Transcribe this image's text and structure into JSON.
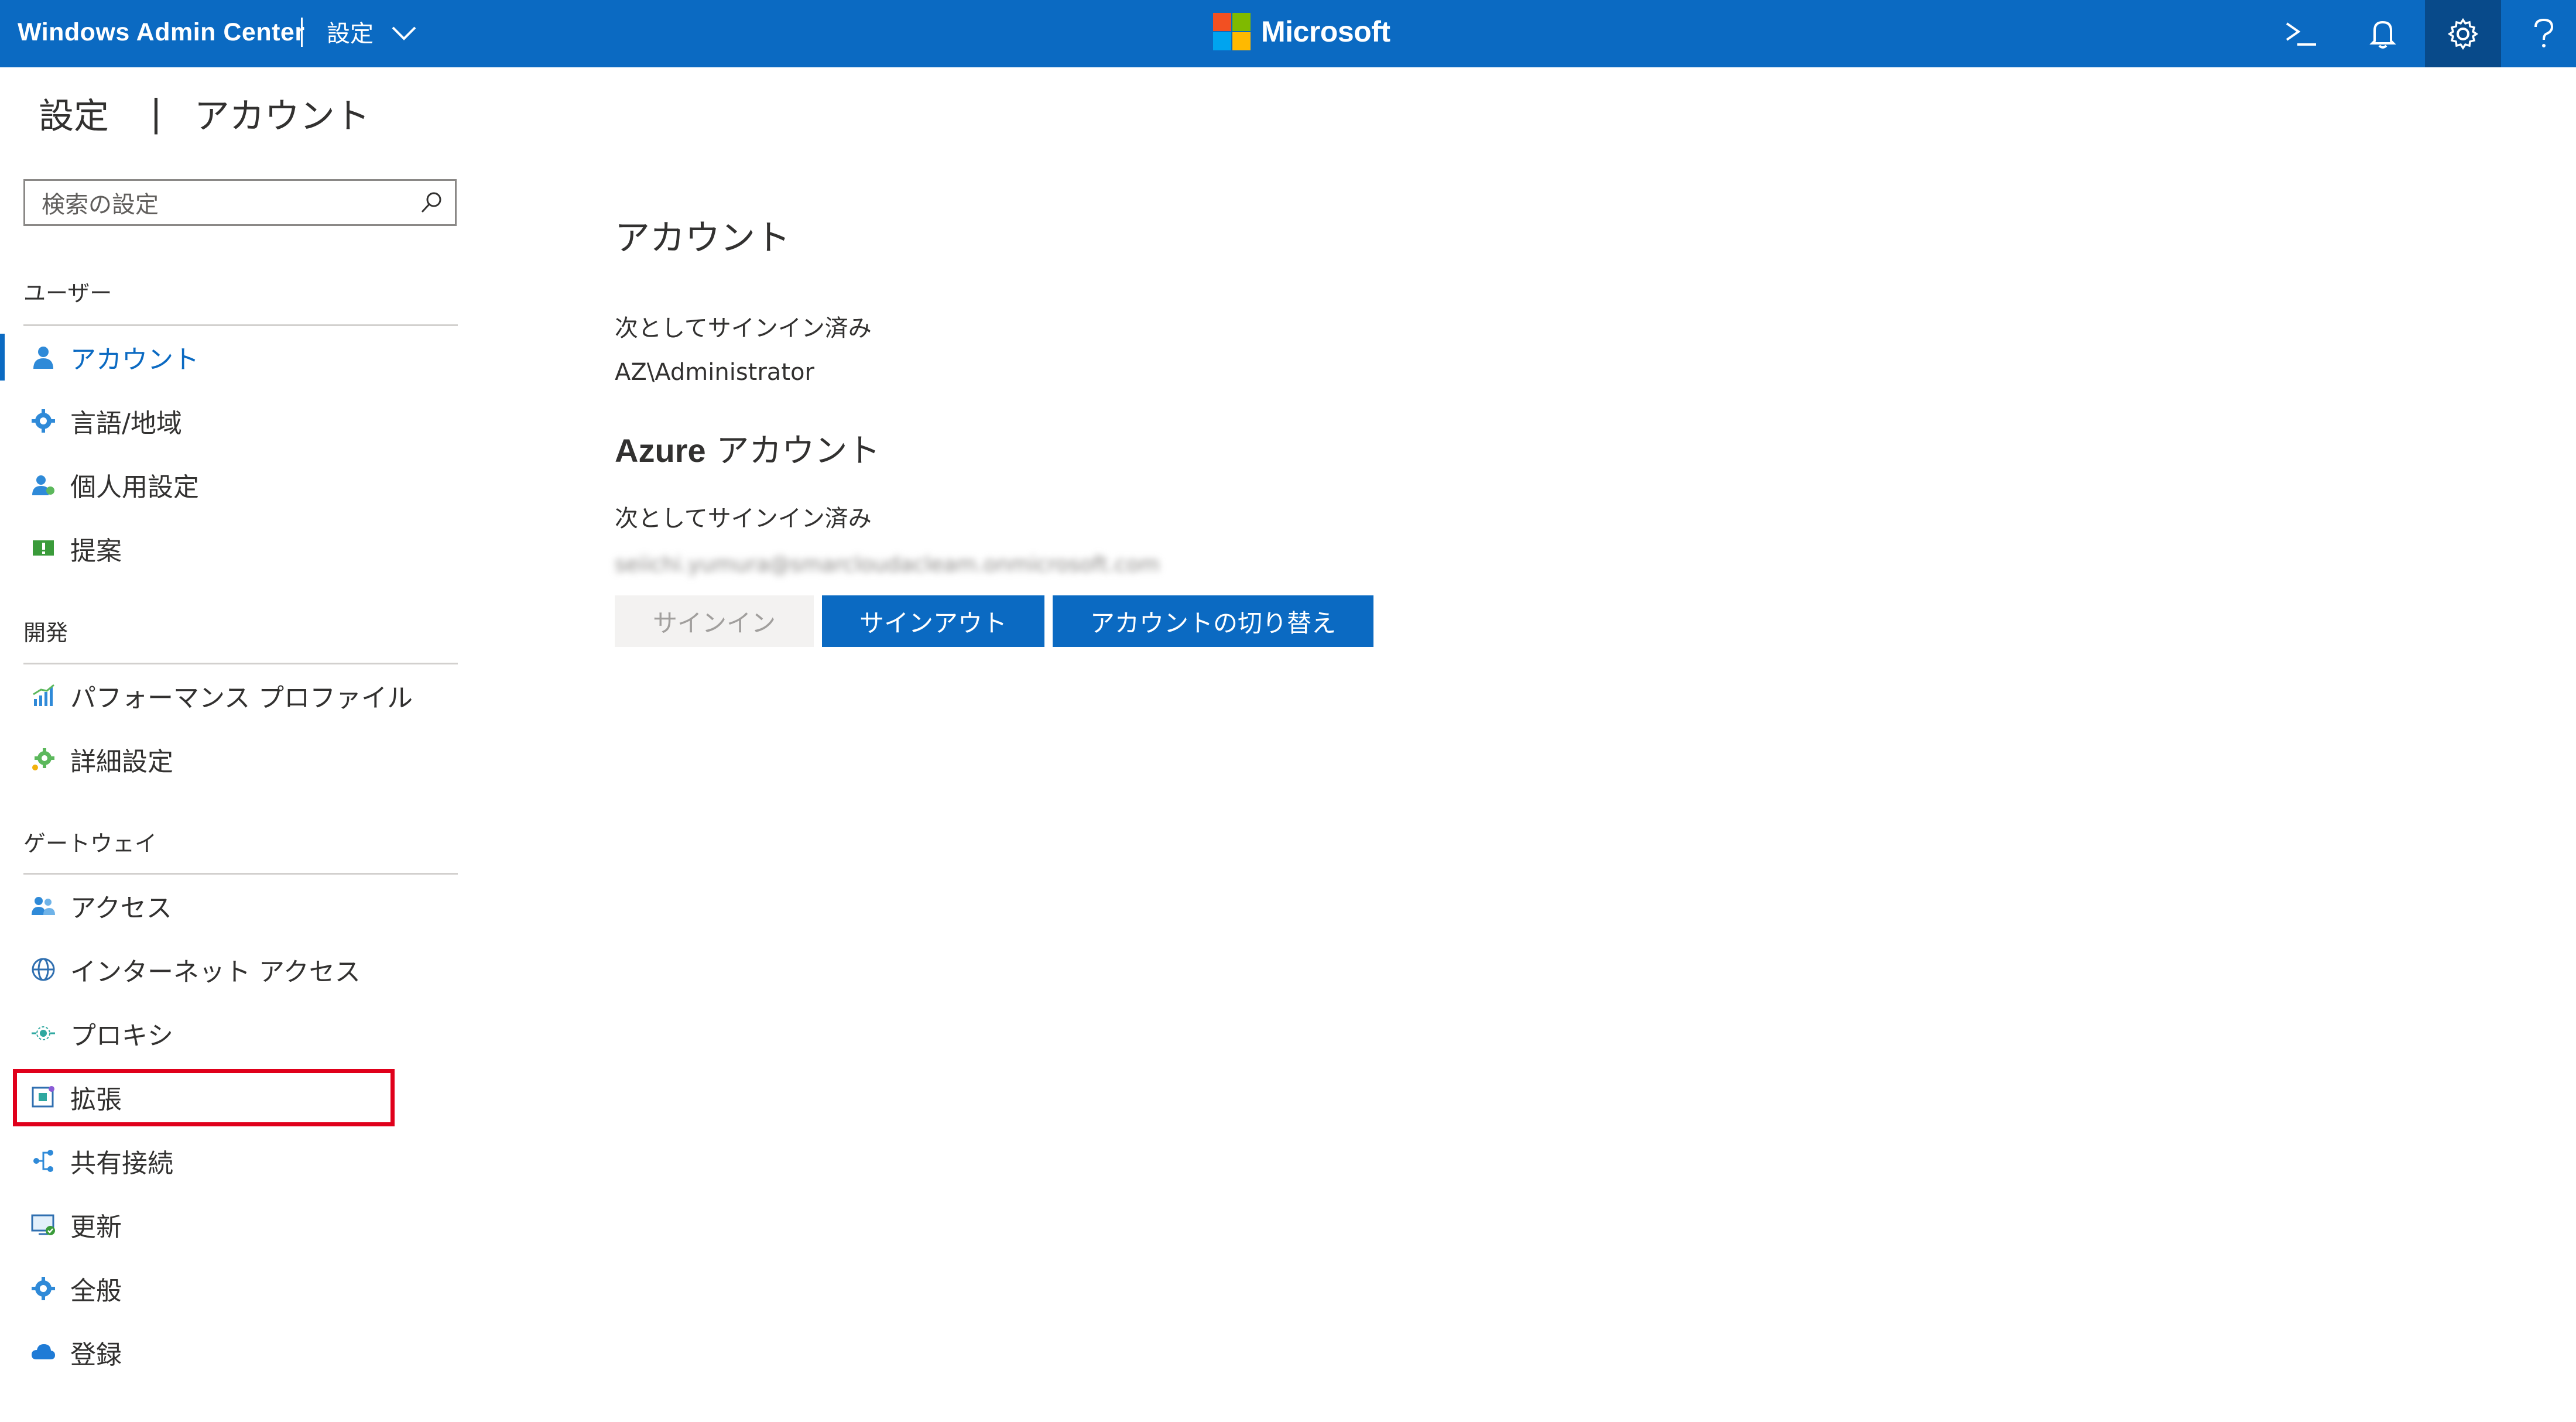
{
  "topbar": {
    "app_title": "Windows Admin Center",
    "breadcrumb": "設定",
    "brand_name": "Microsoft",
    "icons": [
      "powershell-icon",
      "bell-icon",
      "gear-icon",
      "help-icon"
    ],
    "colors": {
      "bar": "#0b6ac2",
      "active": "#084a8a"
    }
  },
  "page": {
    "title_left": "設定",
    "separator": "|",
    "title_right": "アカウント"
  },
  "search": {
    "placeholder": "検索の設定"
  },
  "sidebar": {
    "sections": [
      {
        "label": "ユーザー",
        "items": [
          {
            "label": "アカウント",
            "icon": "person-icon",
            "active": true
          },
          {
            "label": "言語/地域",
            "icon": "gear-icon"
          },
          {
            "label": "個人用設定",
            "icon": "personalize-icon"
          },
          {
            "label": "提案",
            "icon": "feedback-icon"
          }
        ]
      },
      {
        "label": "開発",
        "items": [
          {
            "label": "パフォーマンス プロファイル",
            "icon": "chart-icon"
          },
          {
            "label": "詳細設定",
            "icon": "advanced-gear-icon"
          }
        ]
      },
      {
        "label": "ゲートウェイ",
        "items": [
          {
            "label": "アクセス",
            "icon": "people-icon"
          },
          {
            "label": "インターネット アクセス",
            "icon": "globe-icon"
          },
          {
            "label": "プロキシ",
            "icon": "proxy-icon"
          },
          {
            "label": "拡張",
            "icon": "extension-icon",
            "highlighted": true
          },
          {
            "label": "共有接続",
            "icon": "share-icon"
          },
          {
            "label": "更新",
            "icon": "update-icon"
          },
          {
            "label": "全般",
            "icon": "gear-icon"
          },
          {
            "label": "登録",
            "icon": "cloud-icon"
          }
        ]
      }
    ]
  },
  "main": {
    "heading": "アカウント",
    "signed_in_label": "次としてサインイン済み",
    "signed_in_user": "AZ\\Administrator",
    "azure_heading_bold": "Azure",
    "azure_heading_rest": " アカウント",
    "azure_signed_in_label": "次としてサインイン済み",
    "azure_email_blurred": "seiichi.yumura@smarcloudacleam.onmicrosoft.com",
    "buttons": {
      "signin": "サインイン",
      "signout": "サインアウト",
      "switch_account": "アカウントの切り替え"
    }
  }
}
